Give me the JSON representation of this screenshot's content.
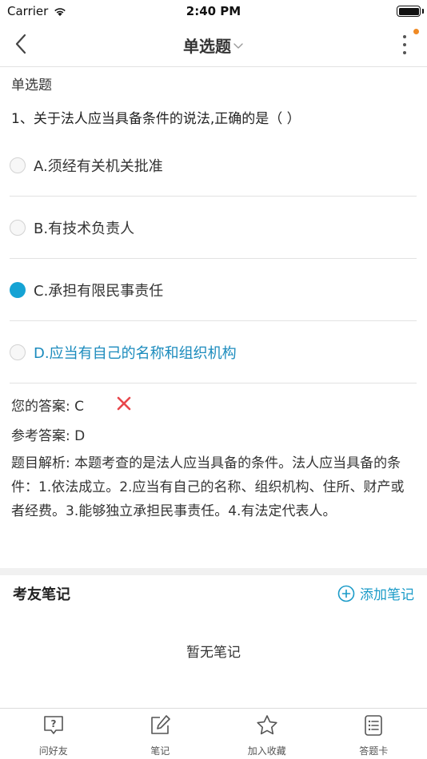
{
  "status_bar": {
    "carrier": "Carrier",
    "time": "2:40 PM"
  },
  "nav": {
    "title": "单选题"
  },
  "question": {
    "type_label": "单选题",
    "stem": "1、关于法人应当具备条件的说法,正确的是（ ）",
    "options": [
      {
        "text": "A.须经有关机关批准",
        "selected": false,
        "correct": false
      },
      {
        "text": "B.有技术负责人",
        "selected": false,
        "correct": false
      },
      {
        "text": "C.承担有限民事责任",
        "selected": true,
        "correct": false
      },
      {
        "text": "D.应当有自己的名称和组织机构",
        "selected": false,
        "correct": true
      }
    ]
  },
  "answers": {
    "yours": "您的答案: C",
    "reference": "参考答案: D",
    "analysis": "题目解析: 本题考查的是法人应当具备的条件。法人应当具备的条件：1.依法成立。2.应当有自己的名称、组织机构、住所、财产或者经费。3.能够独立承担民事责任。4.有法定代表人。"
  },
  "notes": {
    "title": "考友笔记",
    "add_label": "添加笔记",
    "empty": "暂无笔记"
  },
  "tabs": [
    {
      "label": "问好友",
      "icon": "question-bubble-icon"
    },
    {
      "label": "笔记",
      "icon": "edit-note-icon"
    },
    {
      "label": "加入收藏",
      "icon": "star-icon"
    },
    {
      "label": "答题卡",
      "icon": "answer-sheet-icon"
    }
  ],
  "colors": {
    "accent": "#15a3d4",
    "correct_text": "#1b8bbd",
    "wrong_mark": "#e8474c",
    "notification": "#f08a24"
  }
}
